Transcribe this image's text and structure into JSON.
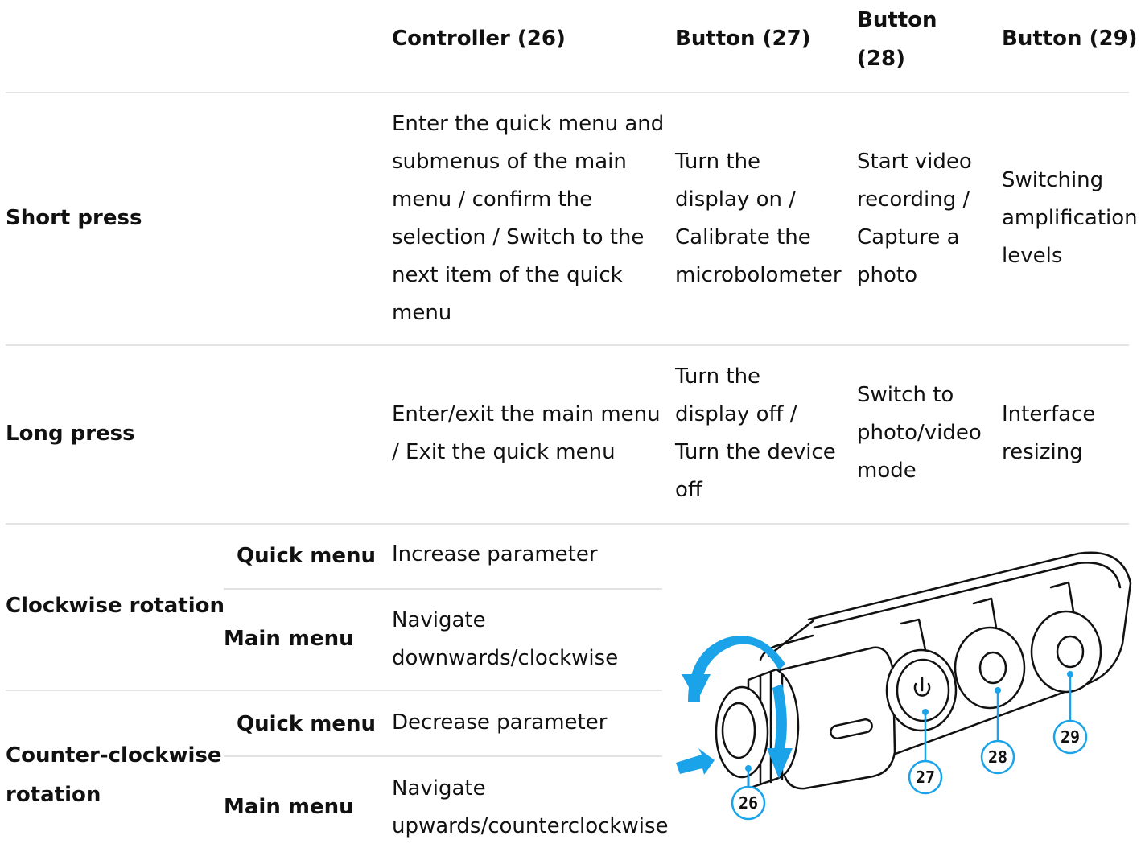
{
  "header": {
    "col1": "Controller (26)",
    "col2": "Button (27)",
    "col3": [
      "Button",
      "(28)"
    ],
    "col4": "Button (29)"
  },
  "short_press": {
    "label": "Short press",
    "controller": [
      "Enter the quick menu and",
      "submenus of the main",
      "menu / confirm the",
      "selection / Switch to the",
      "next item of the quick",
      "menu"
    ],
    "button27": [
      "Turn the",
      "display on /",
      "Calibrate the",
      "microbolometer"
    ],
    "button28": [
      "Start video",
      "recording /",
      "Capture a",
      "photo"
    ],
    "button29": [
      "Switching",
      "amplification",
      "levels"
    ]
  },
  "long_press": {
    "label": "Long press",
    "controller": [
      "Enter/exit the main menu",
      "/ Exit the quick menu"
    ],
    "button27": [
      "Turn the",
      "display off /",
      "Turn the device",
      "off"
    ],
    "button28": [
      "Switch to",
      "photo/video",
      "mode"
    ],
    "button29": [
      "Interface",
      "resizing"
    ]
  },
  "clockwise": {
    "label": "Clockwise rotation",
    "quick_menu_label": "Quick menu",
    "quick_menu_action": "Increase parameter",
    "main_menu_label": "Main menu",
    "main_menu_action": [
      "Navigate",
      "downwards/clockwise"
    ]
  },
  "counter_clockwise": {
    "label": [
      "Counter-clockwise",
      "rotation"
    ],
    "quick_menu_label": "Quick menu",
    "quick_menu_action": "Decrease parameter",
    "main_menu_label": "Main menu",
    "main_menu_action": [
      "Navigate",
      "upwards/counterclockwise"
    ]
  },
  "illustration": {
    "callouts": [
      "26",
      "27",
      "28",
      "29"
    ],
    "accent_color": "#1aa3e8",
    "outline_color": "#111111"
  }
}
